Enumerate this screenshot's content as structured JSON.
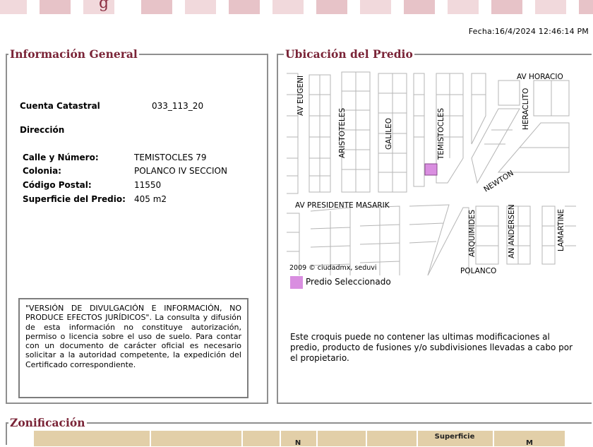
{
  "header": {
    "fecha": "Fecha:16/4/2024 12:46:14 PM"
  },
  "info_general": {
    "title": "Información General",
    "cuenta_label": "Cuenta Catastral",
    "cuenta_value": "033_113_20",
    "direccion_label": "Dirección",
    "fields": [
      {
        "label": "Calle y Número:",
        "value": "TEMISTOCLES 79"
      },
      {
        "label": "Colonia:",
        "value": "POLANCO IV SECCION"
      },
      {
        "label": "Código Postal:",
        "value": "11550"
      },
      {
        "label": "Superficie del Predio:",
        "value": "405 m2"
      }
    ],
    "disclaimer": "\"VERSIÓN DE DIVULGACIÓN E INFORMACIÓN, NO PRODUCE EFECTOS JURÍDICOS\". La consulta y difusión de esta información no constituye autorización, permiso o licencia sobre el uso de suelo. Para contar con un documento de carácter oficial es necesario solicitar a la autoridad competente, la expedición del Certificado correspondiente."
  },
  "ubicacion": {
    "title": "Ubicación del Predio",
    "streets": {
      "av_eugenio": "AV EUGENI",
      "aristoteles": "ARISTOTELES",
      "galileo": "GALILEO",
      "temistocles": "TEMISTOCLES",
      "heraclito": "HERACLITO",
      "av_horacio": "AV HORACIO",
      "newton": "NEWTON",
      "masarik": "AV PRESIDENTE MASARIK",
      "arquimides": "ARQUIMIDES",
      "andersen": "AN ANDERSEN",
      "lamartine": "LAMARTINE",
      "polanco": "POLANCO",
      "copyright": "2009 © ciudadmx, seduvi"
    },
    "legend_label": "Predio Seleccionado",
    "legend_color": "#d98ee0",
    "note": "Este croquis puede no contener las ultimas modificaciones al predio, producto de fusiones y/o subdivisiones llevadas a cabo por el propietario."
  },
  "zonificacion": {
    "title": "Zonificación",
    "header_col_superficie": "Superficie",
    "header_col_n": "N",
    "header_col_m": "M"
  },
  "colors": {
    "accent": "#7a2437",
    "table_header": "#e2cfa8",
    "border": "#8f8f8f"
  }
}
